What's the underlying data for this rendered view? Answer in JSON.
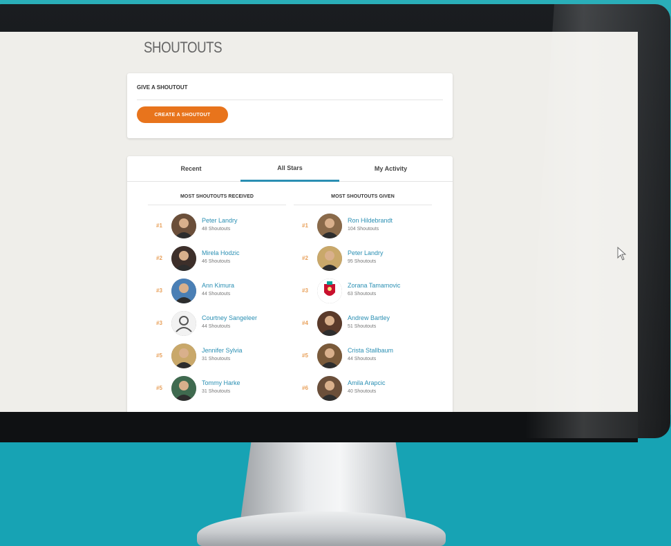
{
  "page": {
    "title": "SHOUTOUTS"
  },
  "give_shoutout": {
    "title": "GIVE A SHOUTOUT",
    "button_label": "CREATE A SHOUTOUT"
  },
  "tabs": [
    {
      "label": "Recent",
      "active": false
    },
    {
      "label": "All Stars",
      "active": true
    },
    {
      "label": "My Activity",
      "active": false
    }
  ],
  "received": {
    "heading": "MOST SHOUTOUTS RECEIVED",
    "entries": [
      {
        "rank": "#1",
        "name": "Peter Landry",
        "count": "48 Shoutouts",
        "avatar": "photo"
      },
      {
        "rank": "#2",
        "name": "Mirela Hodzic",
        "count": "46 Shoutouts",
        "avatar": "photo"
      },
      {
        "rank": "#3",
        "name": "Ann Kimura",
        "count": "44 Shoutouts",
        "avatar": "photo"
      },
      {
        "rank": "#3",
        "name": "Courtney Sangeleer",
        "count": "44 Shoutouts",
        "avatar": "user-icon"
      },
      {
        "rank": "#5",
        "name": "Jennifer Sylvia",
        "count": "31 Shoutouts",
        "avatar": "photo"
      },
      {
        "rank": "#5",
        "name": "Tommy Harke",
        "count": "31 Shoutouts",
        "avatar": "photo"
      }
    ]
  },
  "given": {
    "heading": "MOST SHOUTOUTS GIVEN",
    "entries": [
      {
        "rank": "#1",
        "name": "Ron Hildebrandt",
        "count": "104 Shoutouts",
        "avatar": "photo"
      },
      {
        "rank": "#2",
        "name": "Peter Landry",
        "count": "95 Shoutouts",
        "avatar": "photo"
      },
      {
        "rank": "#3",
        "name": "Zorana Tamamovic",
        "count": "63 Shoutouts",
        "avatar": "club-crest"
      },
      {
        "rank": "#4",
        "name": "Andrew Bartley",
        "count": "51 Shoutouts",
        "avatar": "photo"
      },
      {
        "rank": "#5",
        "name": "Crista Stallbaum",
        "count": "44 Shoutouts",
        "avatar": "photo"
      },
      {
        "rank": "#6",
        "name": "Amila Arapcic",
        "count": "40 Shoutouts",
        "avatar": "photo"
      }
    ]
  },
  "colors": {
    "accent": "#2a8fb3",
    "button": "#e8741c",
    "rank": "#e8a05a",
    "background_teal": "#2aaeb8"
  }
}
